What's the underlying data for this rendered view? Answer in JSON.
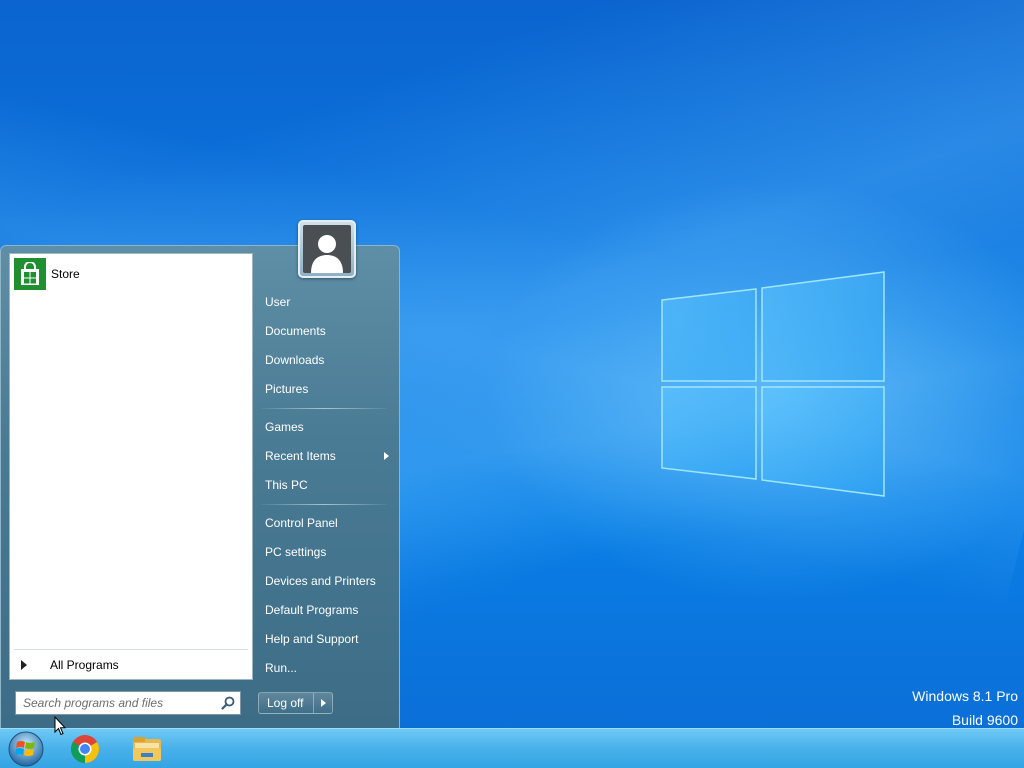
{
  "watermark": {
    "line1": "Windows 8.1 Pro",
    "line2": "Build 9600"
  },
  "start_menu": {
    "pinned": [
      {
        "label": "Store",
        "icon": "store-icon"
      }
    ],
    "all_programs_label": "All Programs",
    "search": {
      "placeholder": "Search programs and files",
      "value": ""
    },
    "user_avatar_icon": "user-avatar-icon",
    "right_items": {
      "group1": [
        "User",
        "Documents",
        "Downloads",
        "Pictures"
      ],
      "group2": [
        "Games",
        "Recent Items",
        "This PC"
      ],
      "group3": [
        "Control Panel",
        "PC settings",
        "Devices and Printers",
        "Default Programs",
        "Help and Support",
        "Run..."
      ]
    },
    "log_off_label": "Log off"
  },
  "taskbar": {
    "items": [
      {
        "name": "start-button",
        "icon": "windows-orb-icon"
      },
      {
        "name": "chrome",
        "icon": "chrome-icon"
      },
      {
        "name": "file-explorer",
        "icon": "folder-icon"
      }
    ]
  },
  "colors": {
    "desktop": "#0a78e2",
    "start_menu": "#4a7b94",
    "taskbar": "#48b1ea",
    "store_tile": "#1f8f2f"
  }
}
